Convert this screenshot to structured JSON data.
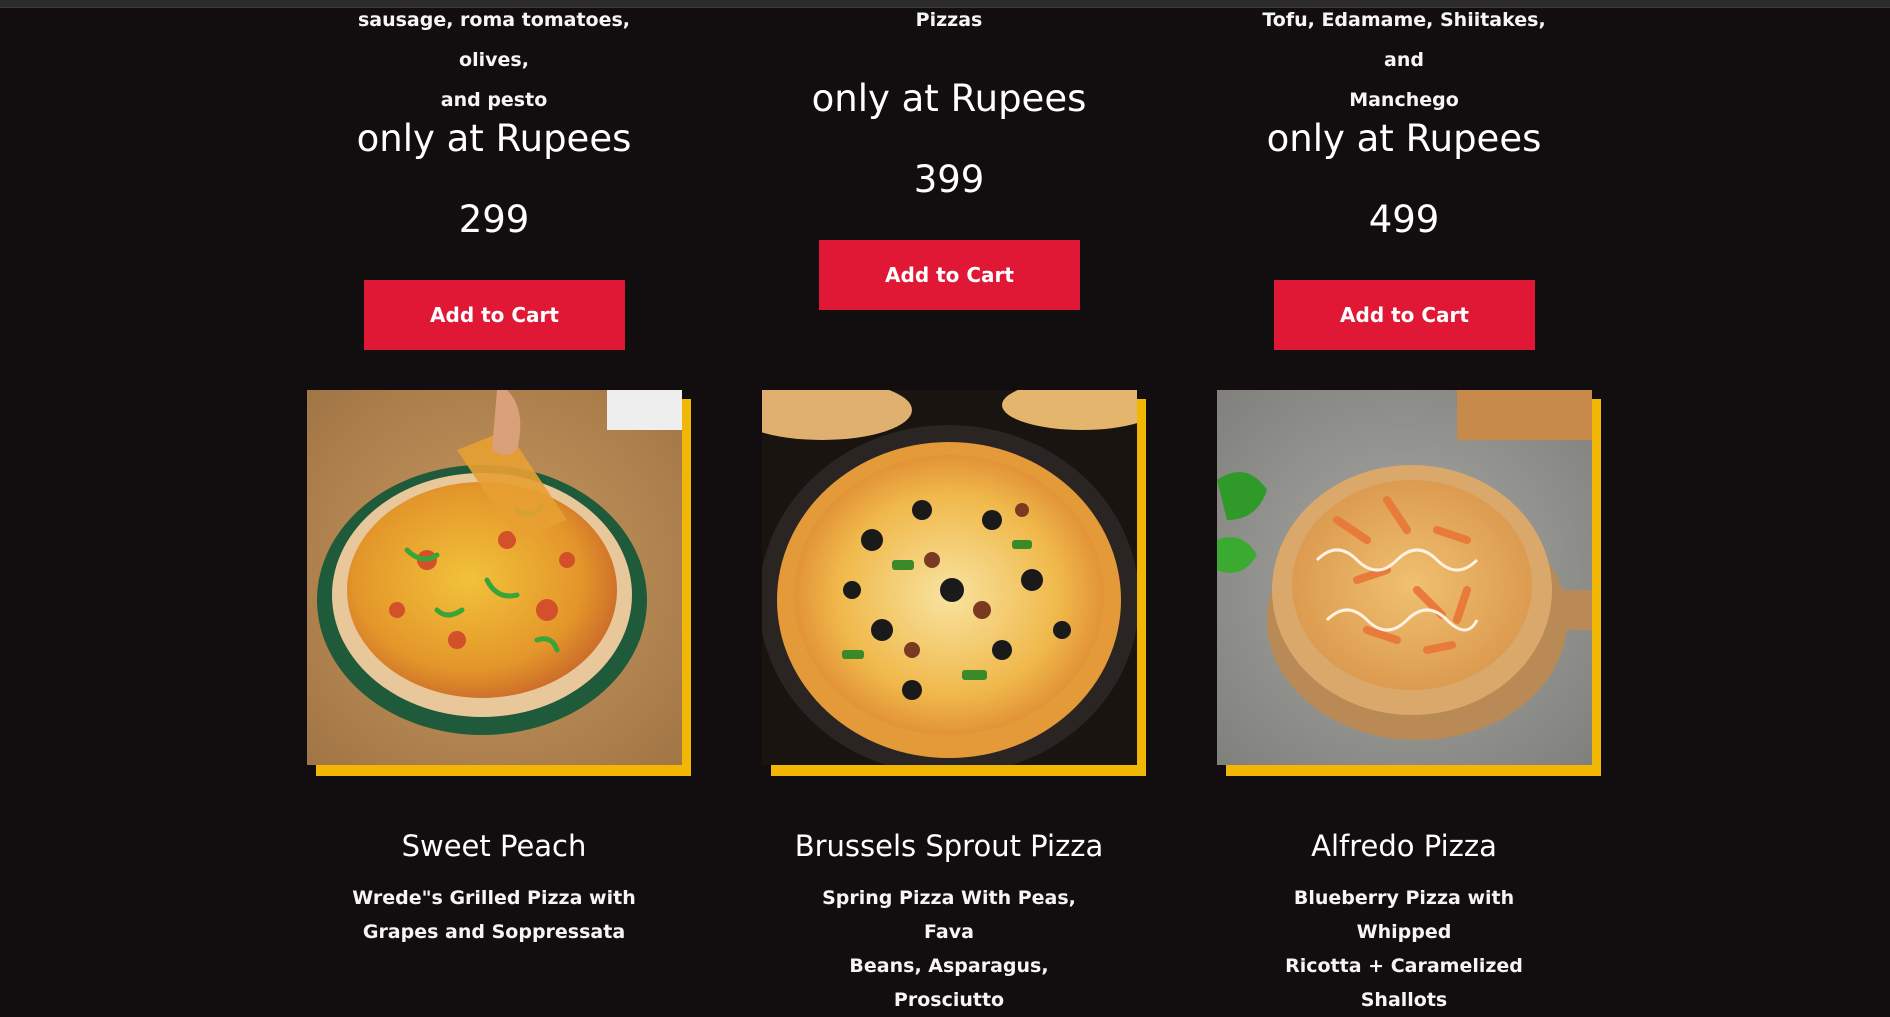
{
  "top_row": [
    {
      "desc_line1": "sausage, roma tomatoes, olives,",
      "desc_line2": "and pesto",
      "price_label": "only at Rupees",
      "price": "299",
      "button": "Add to Cart"
    },
    {
      "desc_line1": "Pizzas",
      "desc_line2": "",
      "price_label": "only at Rupees",
      "price": "399",
      "button": "Add to Cart"
    },
    {
      "desc_line1": "Tofu, Edamame, Shiitakes, and",
      "desc_line2": "Manchego",
      "price_label": "only at Rupees",
      "price": "499",
      "button": "Add to Cart"
    }
  ],
  "bottom_row": [
    {
      "title": "Sweet Peach",
      "desc_line1": "Wrede\"s Grilled Pizza with",
      "desc_line2": "Grapes and Soppressata",
      "image_icon": "pizza-photo-icon"
    },
    {
      "title": "Brussels Sprout Pizza",
      "desc_line1": "Spring Pizza With Peas, Fava",
      "desc_line2": "Beans, Asparagus, Prosciutto",
      "image_icon": "pizza-photo-icon"
    },
    {
      "title": "Alfredo Pizza",
      "desc_line1": "Blueberry Pizza with Whipped",
      "desc_line2": "Ricotta + Caramelized Shallots",
      "image_icon": "pizza-photo-icon"
    }
  ],
  "colors": {
    "background": "#120e0f",
    "button": "#e01836",
    "accent_frame": "#f2b705",
    "text": "#ffffff"
  }
}
